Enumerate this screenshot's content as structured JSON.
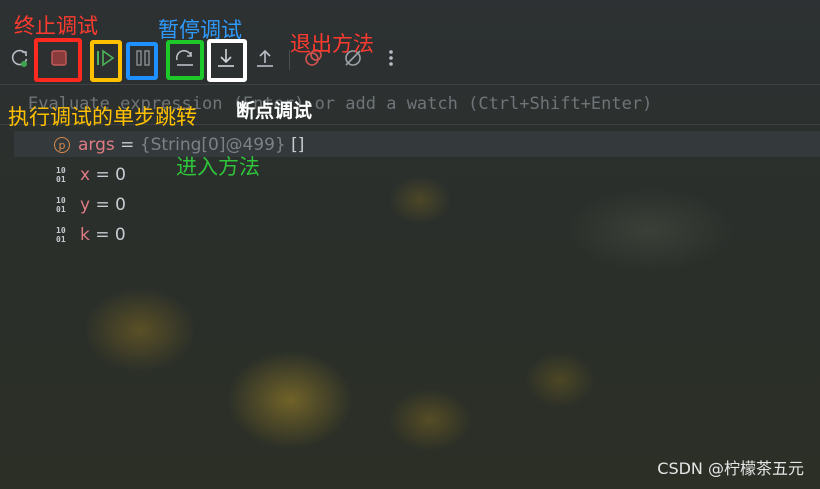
{
  "toolbar": {
    "buttons": [
      {
        "name": "rerun-icon",
        "interactable": true
      },
      {
        "name": "stop-icon",
        "interactable": true
      },
      {
        "name": "resume-icon",
        "interactable": true
      },
      {
        "name": "pause-icon",
        "interactable": true
      },
      {
        "name": "step-over-icon",
        "interactable": true
      },
      {
        "name": "step-into-icon",
        "interactable": true
      },
      {
        "name": "step-out-icon",
        "interactable": true
      },
      {
        "name": "view-breakpoints-icon",
        "interactable": true
      },
      {
        "name": "mute-breakpoints-icon",
        "interactable": true
      },
      {
        "name": "more-icon",
        "interactable": true
      }
    ]
  },
  "watch": {
    "placeholder": "Evaluate expression (Enter) or add a watch (Ctrl+Shift+Enter)"
  },
  "variables": [
    {
      "icon": "param-icon",
      "name": "args",
      "eq": " = ",
      "type": "{String[0]@499} ",
      "value": "[]"
    },
    {
      "icon": "primitive-icon",
      "name": "x",
      "eq": " = ",
      "type": "",
      "value": "0"
    },
    {
      "icon": "primitive-icon",
      "name": "y",
      "eq": " = ",
      "type": "",
      "value": "0"
    },
    {
      "icon": "primitive-icon",
      "name": "k",
      "eq": " = ",
      "type": "",
      "value": "0"
    }
  ],
  "icons": {
    "param_letter": "p",
    "binary_top": "10",
    "binary_bottom": "01"
  },
  "annotations": {
    "stop": {
      "text": "终止调试",
      "color": "#ff3b30"
    },
    "pause": {
      "text": "暂停调试",
      "color": "#2e9bff"
    },
    "exit": {
      "text": "退出方法",
      "color": "#ff3b30"
    },
    "step": {
      "text": "执行调试的单步跳转",
      "color": "#ffc000"
    },
    "breakpoint": {
      "text": "断点调试",
      "color": "#ffffff"
    },
    "enter": {
      "text": "进入方法",
      "color": "#2fc43a"
    }
  },
  "highlight_colors": {
    "stop": "#ff2a1f",
    "resume": "#ffc000",
    "pause": "#1e90ff",
    "step_over": "#1ec72a",
    "step_into": "#ffffff"
  },
  "watermark": "CSDN @柠檬茶五元"
}
